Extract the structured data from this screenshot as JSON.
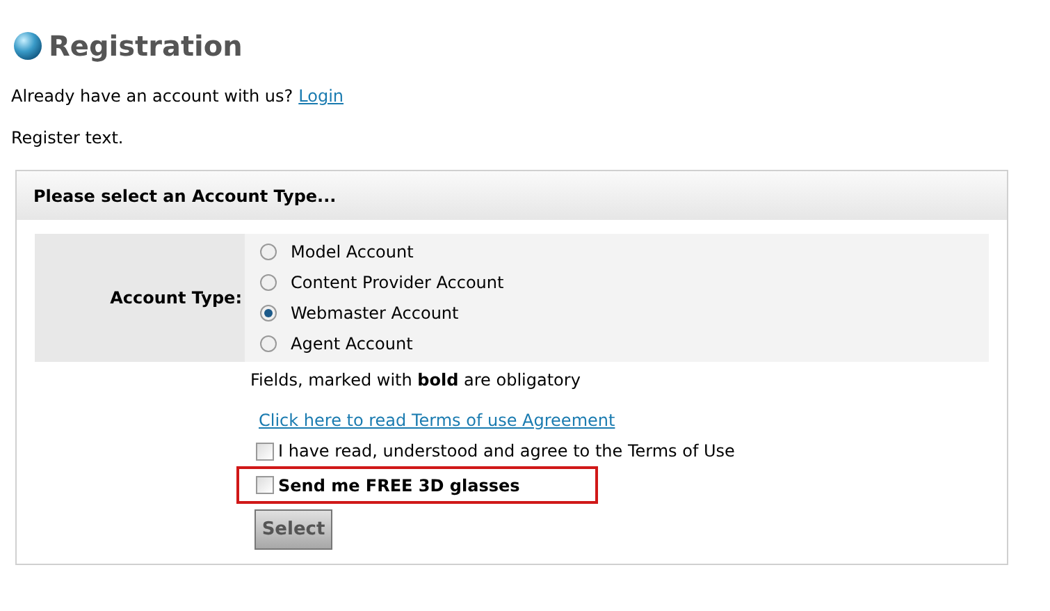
{
  "title": "Registration",
  "login_prompt": {
    "text": "Already have an account with us?",
    "link": "Login"
  },
  "intro": "Register text.",
  "panel": {
    "heading": "Please select an Account Type...",
    "field_label": "Account Type:",
    "options": [
      {
        "label": "Model Account",
        "selected": false
      },
      {
        "label": "Content Provider Account",
        "selected": false
      },
      {
        "label": "Webmaster Account",
        "selected": true
      },
      {
        "label": "Agent Account",
        "selected": false
      }
    ],
    "note": "Fields, marked with **bold** are obligatory",
    "terms_link": "Click here to read Terms of use Agreement",
    "checkboxes": [
      {
        "label": "I have read, understood and agree to the Terms of Use",
        "checked": false,
        "bold": false,
        "highlighted": false
      },
      {
        "label": "Send me FREE 3D glasses",
        "checked": false,
        "bold": true,
        "highlighted": true
      }
    ],
    "button": "Select"
  }
}
